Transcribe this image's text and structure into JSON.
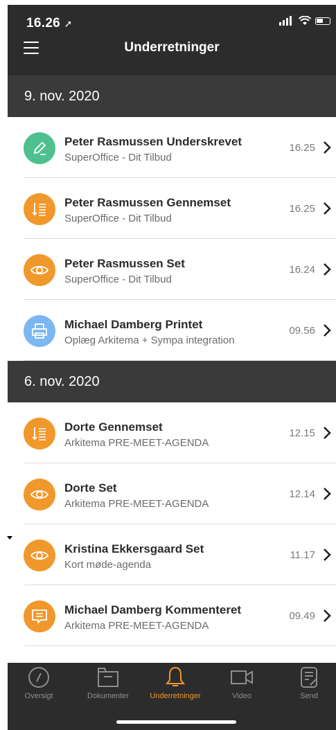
{
  "status": {
    "time": "16.26"
  },
  "header": {
    "title": "Underretninger"
  },
  "sections": [
    {
      "date": "9. nov. 2020",
      "items": [
        {
          "title": "Peter Rasmussen Underskrevet",
          "subtitle": "SuperOffice - Dit Tilbud",
          "time": "16.25",
          "icon": "pen-icon",
          "color": "#4fc08d"
        },
        {
          "title": "Peter Rasmussen Gennemset",
          "subtitle": "SuperOffice - Dit Tilbud",
          "time": "16.25",
          "icon": "read-list-icon",
          "color": "#f0982c"
        },
        {
          "title": "Peter Rasmussen Set",
          "subtitle": "SuperOffice - Dit Tilbud",
          "time": "16.24",
          "icon": "eye-icon",
          "color": "#f0982c"
        },
        {
          "title": "Michael Damberg Printet",
          "subtitle": "Oplæg Arkitema + Sympa integration",
          "time": "09.56",
          "icon": "printer-icon",
          "color": "#7cb7f2"
        }
      ]
    },
    {
      "date": "6. nov. 2020",
      "items": [
        {
          "title": "Dorte  Gennemset",
          "subtitle": "Arkitema PRE-MEET-AGENDA",
          "time": "12.15",
          "icon": "read-list-icon",
          "color": "#f0982c"
        },
        {
          "title": "Dorte  Set",
          "subtitle": "Arkitema PRE-MEET-AGENDA",
          "time": "12.14",
          "icon": "eye-icon",
          "color": "#f0982c"
        },
        {
          "title": "Kristina Ekkersgaard Set",
          "subtitle": "Kort møde-agenda",
          "time": "11.17",
          "icon": "eye-icon",
          "color": "#f0982c"
        },
        {
          "title": "Michael Damberg Kommenteret",
          "subtitle": "Arkitema PRE-MEET-AGENDA",
          "time": "09.49",
          "icon": "comment-icon",
          "color": "#f0982c"
        }
      ]
    }
  ],
  "tabs": [
    {
      "label": "Oversigt",
      "icon": "compass-icon"
    },
    {
      "label": "Dokumenter",
      "icon": "folder-icon"
    },
    {
      "label": "Underretninger",
      "icon": "bell-icon",
      "active": true
    },
    {
      "label": "Video",
      "icon": "video-icon"
    },
    {
      "label": "Send",
      "icon": "send-document-icon"
    }
  ],
  "colors": {
    "bar": "#2c2c2c",
    "section": "#3a3a3a",
    "accent": "#f0982c",
    "green": "#4fc08d",
    "blue": "#7cb7f2"
  }
}
